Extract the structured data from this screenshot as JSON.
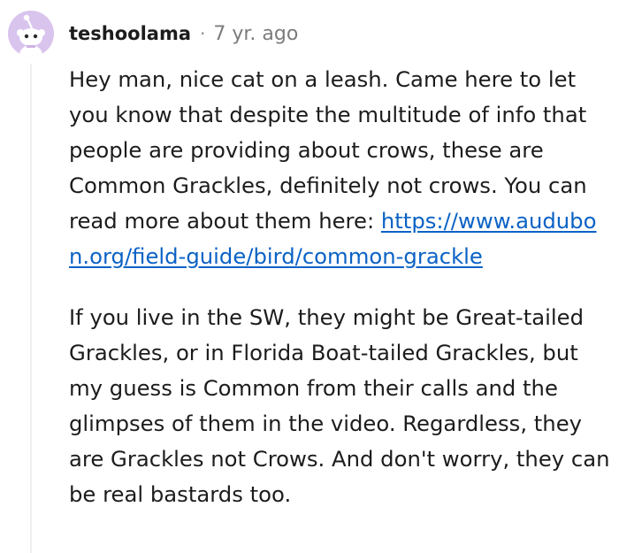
{
  "comment": {
    "author": "teshoolama",
    "separator": "·",
    "timestamp": "7 yr. ago",
    "paragraph1_text": "Hey man, nice cat on a leash. Came here to let you know that despite the multitude of info that people are providing about crows, these are Common Grackles, definitely not crows. You can read more about them here:",
    "link_text": "https://www.audubon.org/field-guide/bird/common-grackle",
    "paragraph2_text": "If you live in the SW, they might be Great-tailed Grackles, or in Florida Boat-tailed Grackles, but my guess is Common from their calls and the glimpses of them in the video. Regardless, they are Grackles not Crows. And don't worry, they can be real bastards too."
  },
  "avatar": {
    "icon": "snoo-avatar-icon",
    "background_color": "#d9c4ee"
  },
  "colors": {
    "text": "#1c1c1c",
    "meta": "#7c7c7c",
    "link": "#0a62c5",
    "thread_line": "#edeff1"
  }
}
